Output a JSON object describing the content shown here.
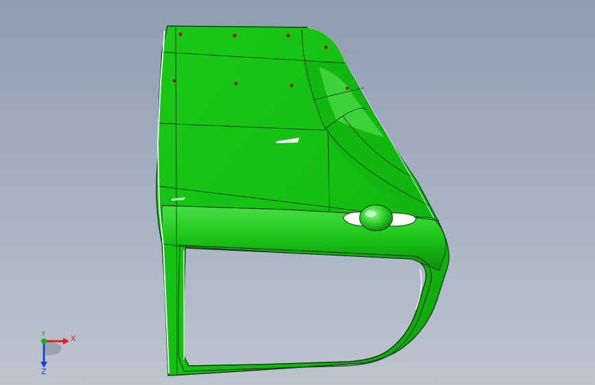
{
  "viewport": {
    "background_top": "#8f9db1",
    "background_bottom": "#bcc4cf"
  },
  "model": {
    "color_main": "#17c414",
    "color_shadow": "#0f9a0c",
    "color_light": "#4fe04a",
    "edge_color": "#0b3a0b",
    "marker_color": "#c8102e"
  },
  "triad": {
    "x_label": "X",
    "y_label": "Y",
    "z_label": "Z",
    "x_color": "#e02020",
    "y_color": "#1faa1f",
    "z_color": "#2040d0"
  }
}
